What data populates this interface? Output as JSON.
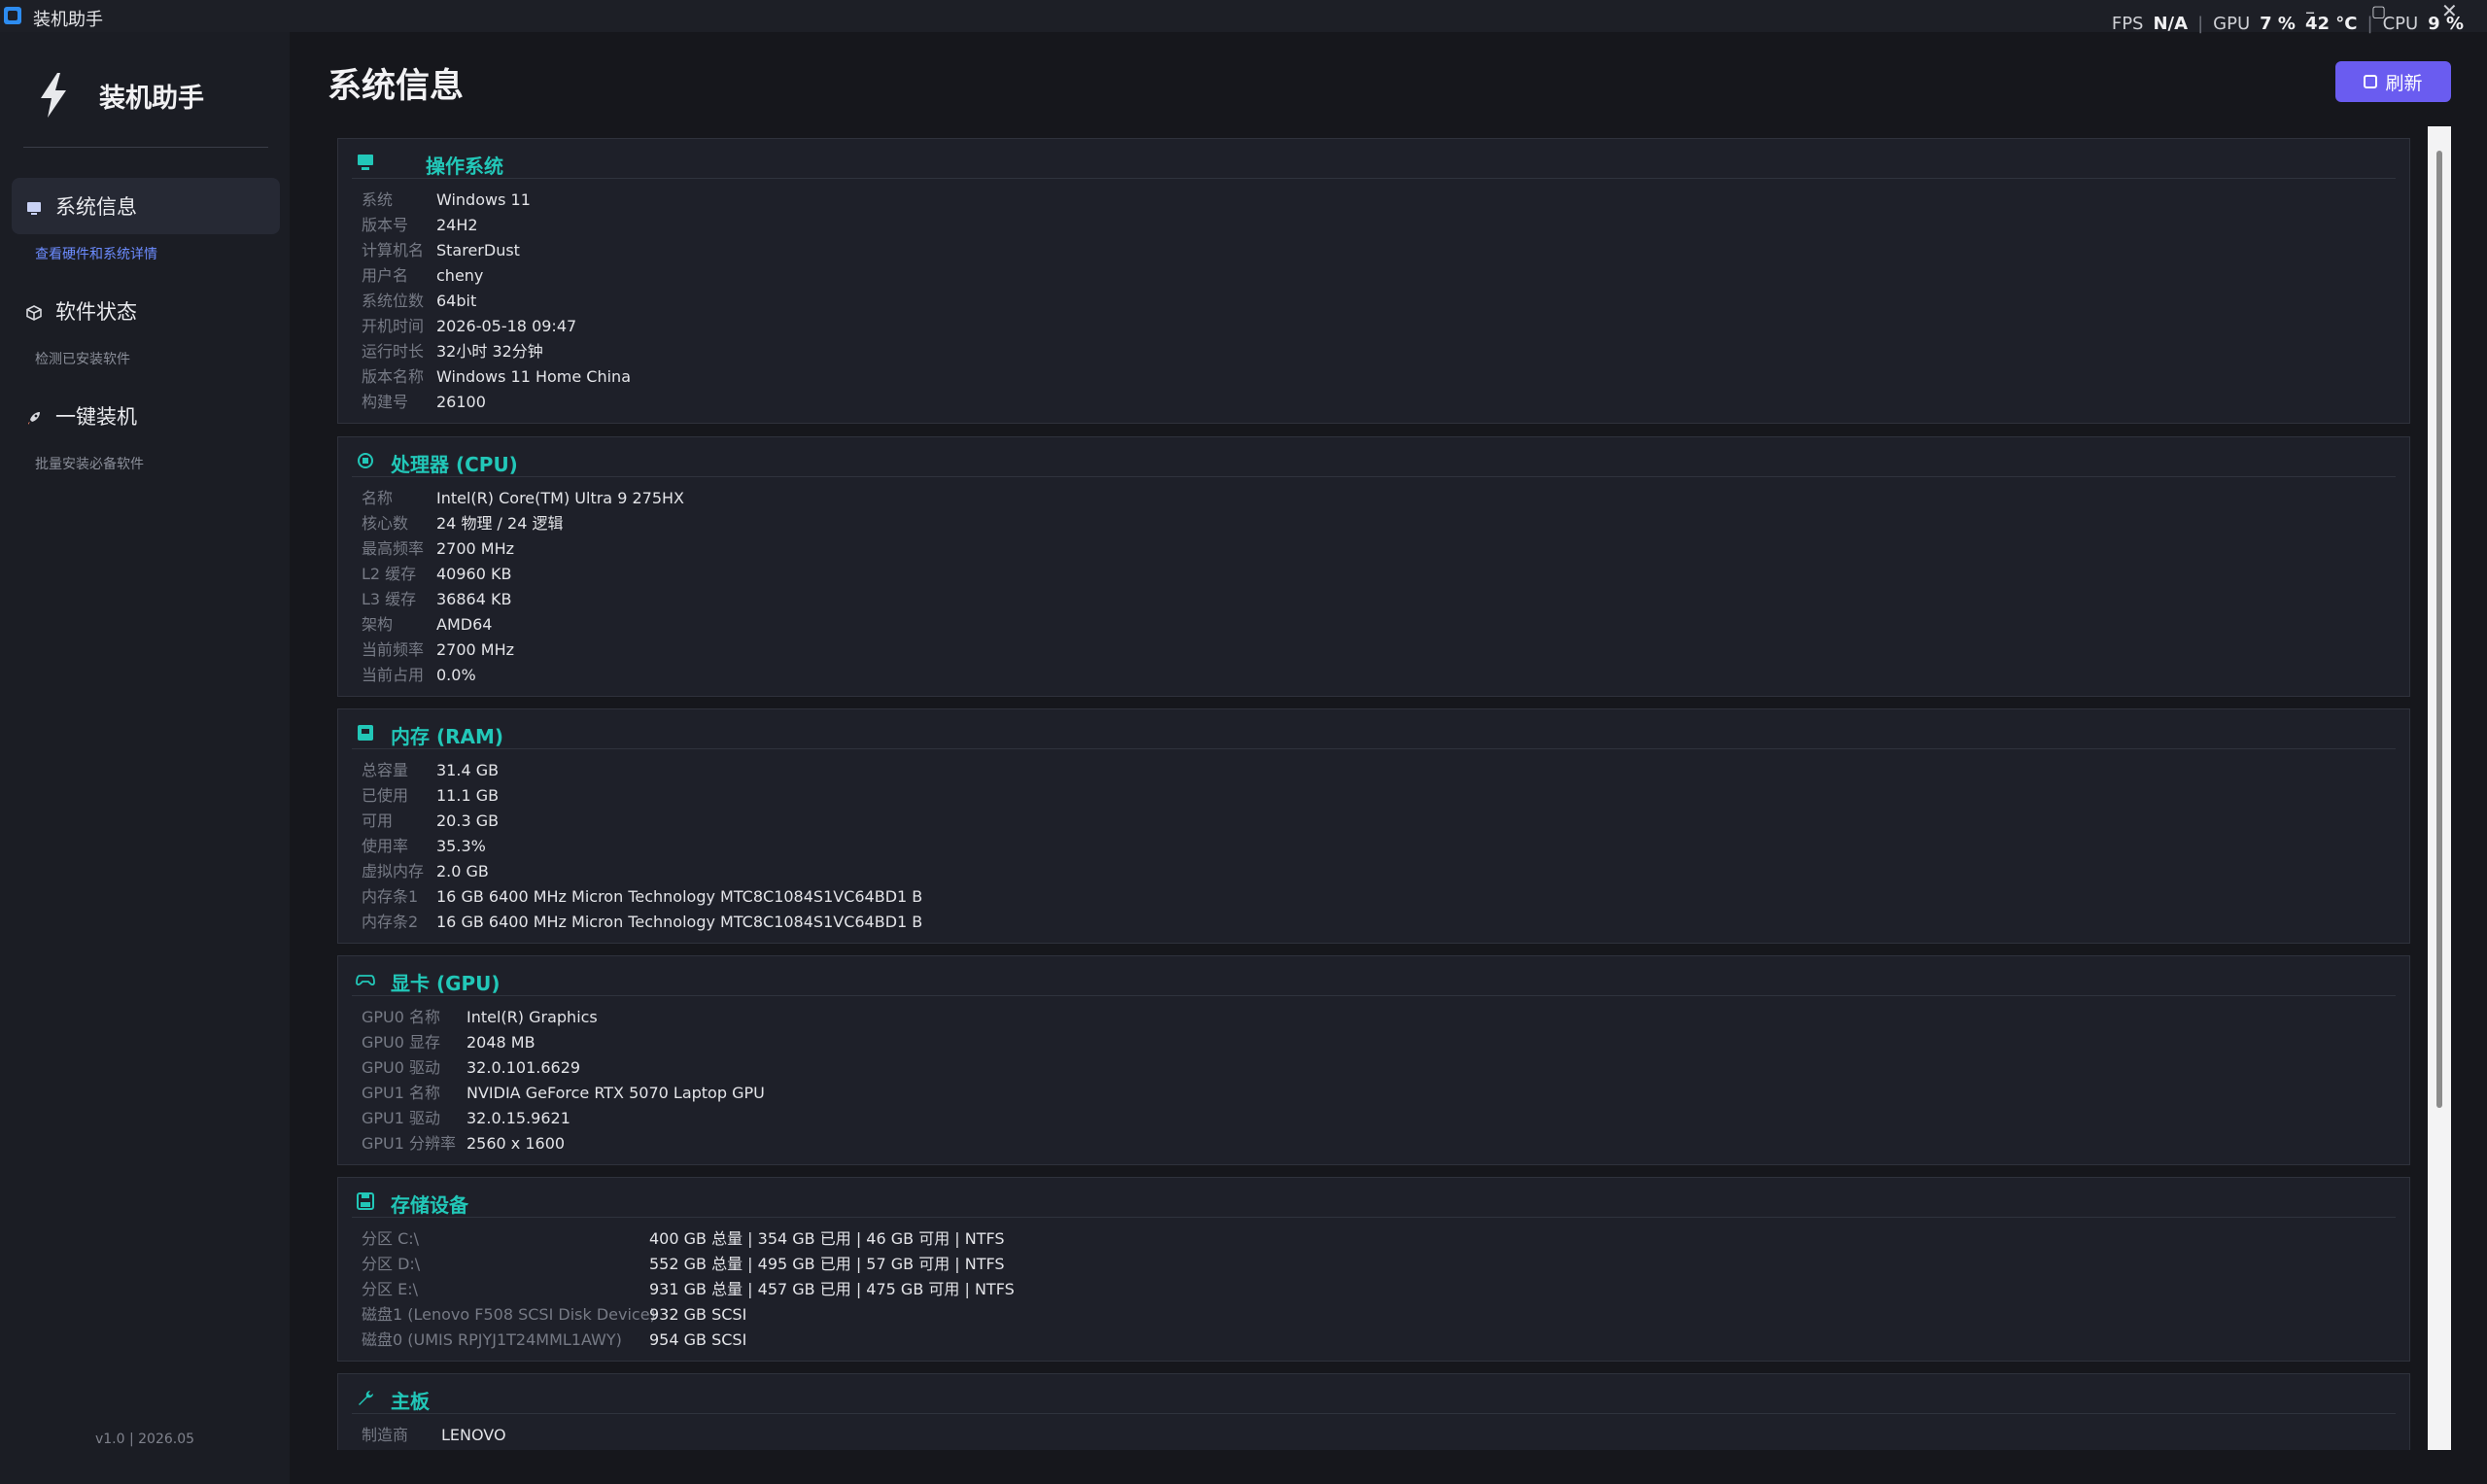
{
  "window": {
    "title": "装机助手",
    "stats": {
      "fps_label": "FPS",
      "fps_value": "N/A",
      "gpu_label": "GPU",
      "gpu_value": "7 %",
      "gpu_temp": "42 °C",
      "cpu_label": "CPU",
      "cpu_value": "9 %",
      "separator": "|"
    },
    "controls": {
      "minimize": "–",
      "restore": "▢",
      "close": "✕"
    }
  },
  "sidebar": {
    "brand": "装机助手",
    "items": [
      {
        "label": "系统信息",
        "sub": "查看硬件和系统详情",
        "icon": "monitor-icon",
        "active": true
      },
      {
        "label": "软件状态",
        "sub": "检测已安装软件",
        "icon": "package-icon",
        "active": false
      },
      {
        "label": "一键装机",
        "sub": "批量安装必备软件",
        "icon": "rocket-icon",
        "active": false
      }
    ],
    "version": "v1.0 | 2026.05"
  },
  "header": {
    "title": "系统信息",
    "refresh_label": "刷新"
  },
  "colors": {
    "accent": "#6a5cf0",
    "section_title": "#22c7b8",
    "background": "#16171c",
    "card": "#1e2029"
  },
  "sections": [
    {
      "title": "操作系统",
      "icon": "monitor-icon",
      "rows": [
        {
          "k": "系统",
          "v": "Windows 11"
        },
        {
          "k": "版本号",
          "v": "24H2"
        },
        {
          "k": "计算机名",
          "v": "StarerDust"
        },
        {
          "k": "用户名",
          "v": "cheny"
        },
        {
          "k": "系统位数",
          "v": "64bit"
        },
        {
          "k": "开机时间",
          "v": "2026-05-18 09:47"
        },
        {
          "k": "运行时长",
          "v": "32小时 32分钟"
        },
        {
          "k": "版本名称",
          "v": "Windows 11 Home China"
        },
        {
          "k": "构建号",
          "v": "26100"
        }
      ]
    },
    {
      "title": "处理器 (CPU)",
      "icon": "cpu-icon",
      "rows": [
        {
          "k": "名称",
          "v": "Intel(R) Core(TM) Ultra 9 275HX"
        },
        {
          "k": "核心数",
          "v": "24 物理 / 24 逻辑"
        },
        {
          "k": "最高频率",
          "v": "2700 MHz"
        },
        {
          "k": "L2 缓存",
          "v": "40960 KB"
        },
        {
          "k": "L3 缓存",
          "v": "36864 KB"
        },
        {
          "k": "架构",
          "v": "AMD64"
        },
        {
          "k": "当前频率",
          "v": "2700 MHz"
        },
        {
          "k": "当前占用",
          "v": "0.0%"
        }
      ]
    },
    {
      "title": "内存 (RAM)",
      "icon": "memory-icon",
      "rows": [
        {
          "k": "总容量",
          "v": "31.4 GB"
        },
        {
          "k": "已使用",
          "v": "11.1 GB"
        },
        {
          "k": "可用",
          "v": "20.3 GB"
        },
        {
          "k": "使用率",
          "v": "35.3%"
        },
        {
          "k": "虚拟内存",
          "v": "2.0 GB"
        },
        {
          "k": "内存条1",
          "v": "16 GB  6400 MHz  Micron Technology  MTC8C1084S1VC64BD1 B"
        },
        {
          "k": "内存条2",
          "v": "16 GB  6400 MHz  Micron Technology  MTC8C1084S1VC64BD1 B"
        }
      ]
    },
    {
      "title": "显卡 (GPU)",
      "icon": "gamepad-icon",
      "rows": [
        {
          "k": "GPU0 名称",
          "v": "Intel(R) Graphics"
        },
        {
          "k": "GPU0 显存",
          "v": "2048 MB"
        },
        {
          "k": "GPU0 驱动",
          "v": "32.0.101.6629"
        },
        {
          "k": "GPU1 名称",
          "v": "NVIDIA GeForce RTX 5070 Laptop GPU"
        },
        {
          "k": "GPU1 驱动",
          "v": "32.0.15.9621"
        },
        {
          "k": "GPU1 分辨率",
          "v": "2560 x 1600"
        }
      ]
    },
    {
      "title": "存储设备",
      "icon": "disk-icon",
      "rows": [
        {
          "k": "分区 C:\\",
          "v": "400 GB 总量 | 354 GB 已用 | 46 GB 可用 | NTFS"
        },
        {
          "k": "分区 D:\\",
          "v": "552 GB 总量 | 495 GB 已用 | 57 GB 可用 | NTFS"
        },
        {
          "k": "分区 E:\\",
          "v": "931 GB 总量 | 457 GB 已用 | 475 GB 可用 | NTFS"
        },
        {
          "k": "磁盘1 (Lenovo F508 SCSI Disk Device)",
          "v": "932 GB  SCSI"
        },
        {
          "k": "磁盘0 (UMIS RPJYJ1T24MML1AWY)",
          "v": "954 GB  SCSI"
        }
      ]
    },
    {
      "title": "主板",
      "icon": "wrench-icon",
      "rows": [
        {
          "k": "制造商",
          "v": "LENOVO"
        }
      ]
    }
  ]
}
